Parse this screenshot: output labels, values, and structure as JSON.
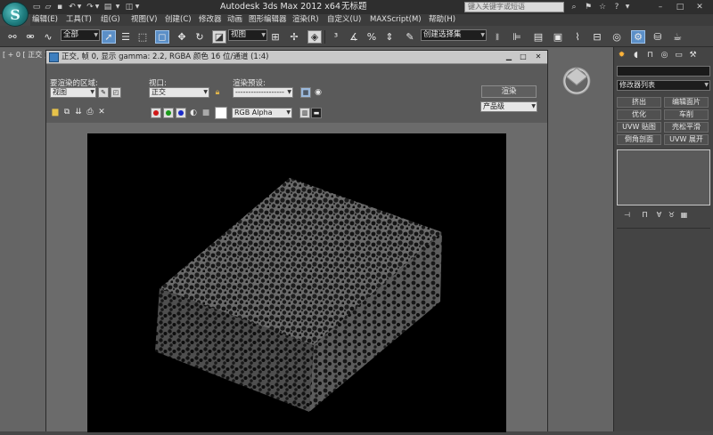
{
  "app": {
    "logo_letter": "S",
    "title": "Autodesk 3ds Max  2012 x64",
    "filename": "无标题",
    "search_placeholder": "键入关键字或短语"
  },
  "menu": [
    "编辑(E)",
    "工具(T)",
    "组(G)",
    "视图(V)",
    "创建(C)",
    "修改器",
    "动画",
    "图形编辑器",
    "渲染(R)",
    "自定义(U)",
    "MAXScript(M)",
    "帮助(H)"
  ],
  "toolbar": {
    "selection_filter": "全部",
    "ref_coord": "视图",
    "named_selection": "创建选择集"
  },
  "viewport": {
    "label": "[ + 0 [ 正交 ]"
  },
  "render_window": {
    "title": "正交, 帧 0, 显示 gamma: 2.2, RGBA 颜色 16 位/通道 (1:4)",
    "area_label": "要渲染的区域:",
    "area_value": "视图",
    "viewport_label": "视口:",
    "viewport_value": "正交",
    "preset_label": "渲染预设:",
    "preset_value": "-------------------",
    "render_button": "渲染",
    "production_value": "产品级",
    "channel_value": "RGB Alpha"
  },
  "command_panel": {
    "modifier_list": "修改器列表",
    "buttons": [
      "挤出",
      "编辑面片",
      "优化",
      "车削",
      "UVW 贴图",
      "壳松平滑",
      "倒角剖面",
      "UVW 展开"
    ]
  },
  "colors": {
    "accent": "#5b8fc7",
    "command_tab_active": "#ffb43a"
  }
}
